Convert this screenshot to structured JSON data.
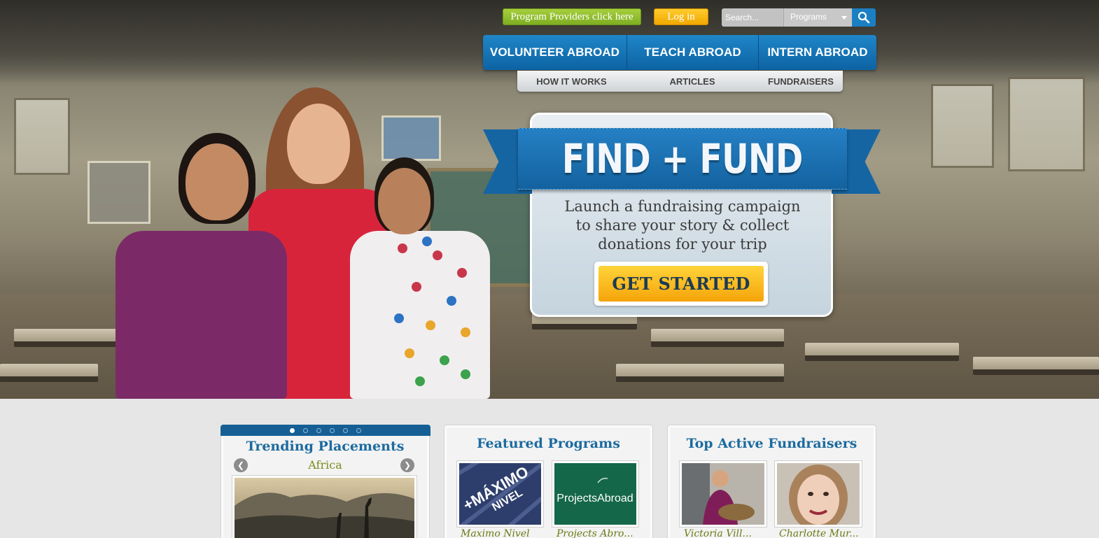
{
  "utility": {
    "providers_label": "Program Providers click here",
    "login_label": "Log in",
    "search_placeholder": "Search...",
    "search_category": "Programs",
    "search_icon": "search-icon"
  },
  "main_nav": {
    "items": [
      "VOLUNTEER ABROAD",
      "TEACH ABROAD",
      "INTERN ABROAD"
    ]
  },
  "sub_nav": {
    "items": [
      "HOW IT WORKS",
      "ARTICLES",
      "FUNDRAISERS"
    ]
  },
  "hero": {
    "title": "FIND + FUND",
    "line1": "Launch a fundraising campaign",
    "line2": "to share your story & collect",
    "line3": "donations for your trip",
    "cta_label": "GET STARTED"
  },
  "trending": {
    "title": "Trending Placements",
    "region": "Africa",
    "dots": 6,
    "active_dot": 1
  },
  "featured": {
    "title": "Featured Programs",
    "items": [
      {
        "caption": "Maximo Nivel",
        "logo_text_1": "+MÁXIMO",
        "logo_text_2": "NIVEL",
        "color": "#2e3e6c"
      },
      {
        "caption": "Projects Abro...",
        "logo_text_1": "ProjectsAbroad",
        "color": "#15674a"
      }
    ]
  },
  "fundraisers": {
    "title": "Top Active Fundraisers",
    "items": [
      {
        "caption": "Victoria Vill..."
      },
      {
        "caption": "Charlotte Mur..."
      }
    ]
  }
}
